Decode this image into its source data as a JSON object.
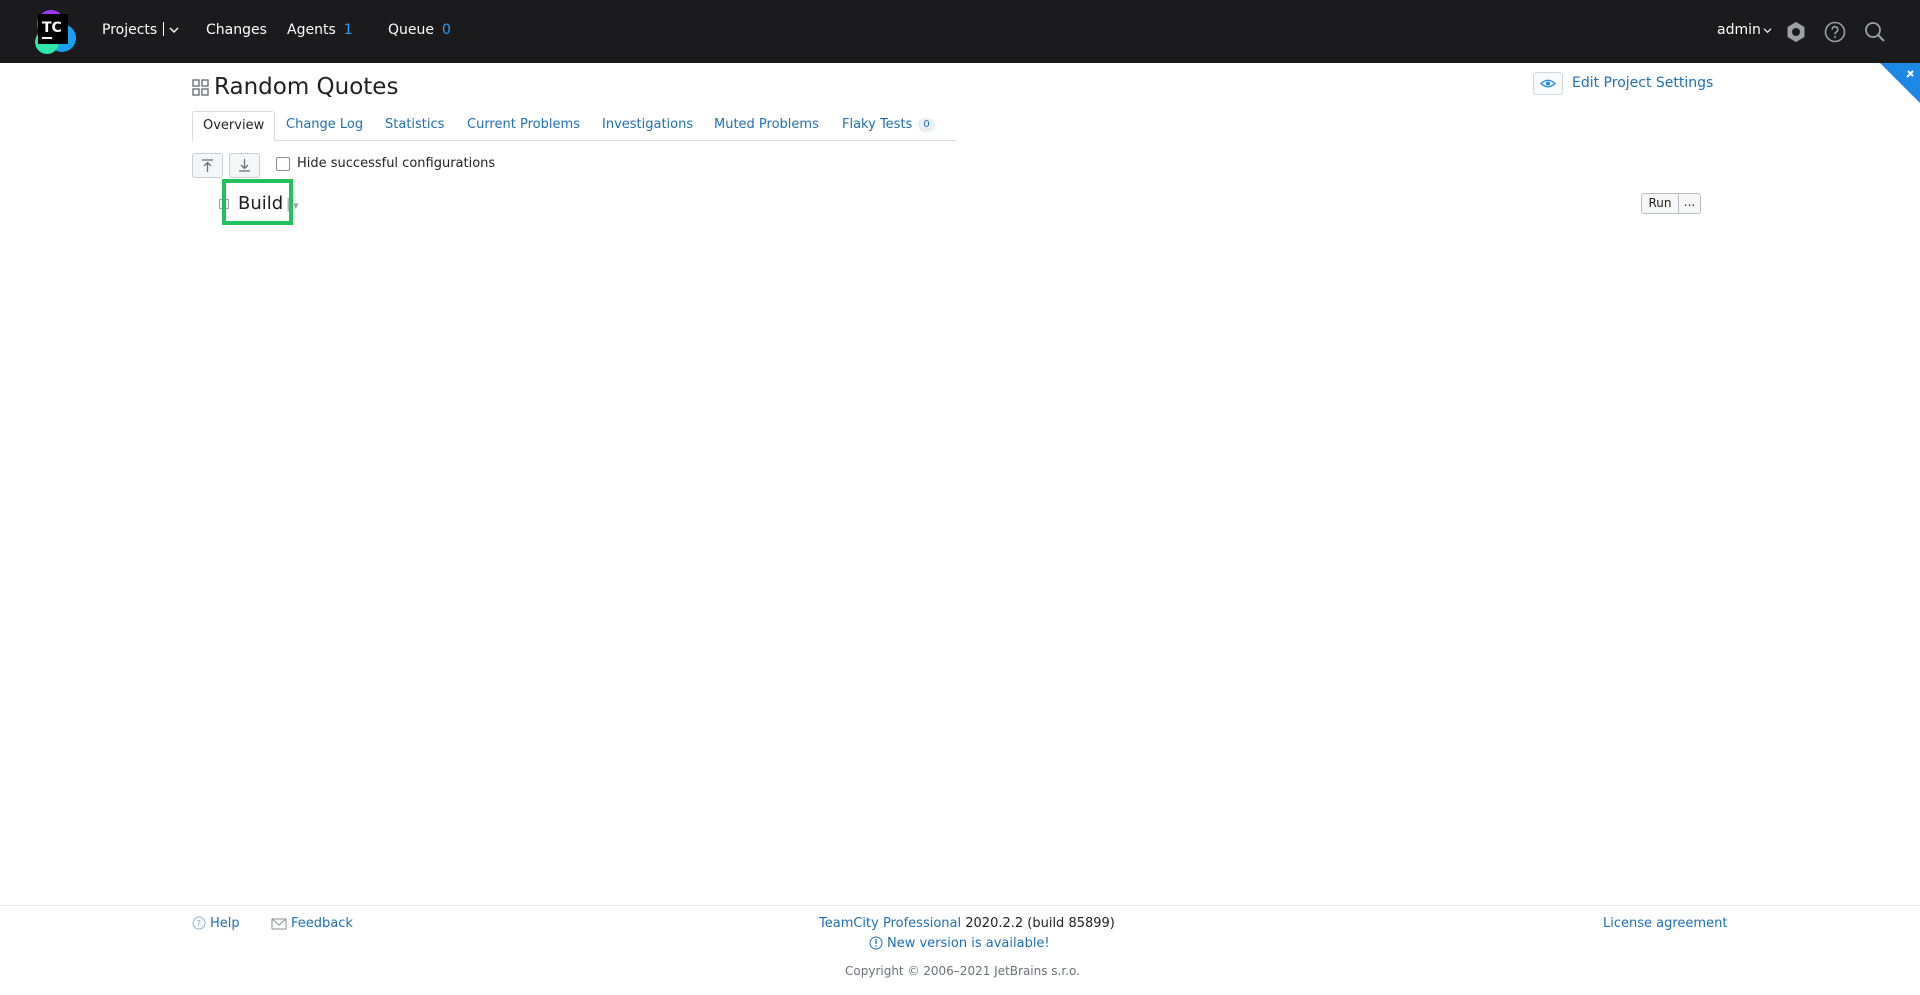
{
  "nav": {
    "projects": "Projects",
    "changes": "Changes",
    "agents": "Agents",
    "agents_count": "1",
    "queue": "Queue",
    "queue_count": "0",
    "user": "admin"
  },
  "header": {
    "title": "Random Quotes",
    "edit_settings": "Edit Project Settings"
  },
  "tabs": [
    {
      "label": "Overview",
      "active": true
    },
    {
      "label": "Change Log"
    },
    {
      "label": "Statistics"
    },
    {
      "label": "Current Problems"
    },
    {
      "label": "Investigations"
    },
    {
      "label": "Muted Problems"
    },
    {
      "label": "Flaky Tests",
      "badge": "0"
    }
  ],
  "toolbar": {
    "hide_successful": "Hide successful configurations"
  },
  "build": {
    "name": "Build",
    "pipe": "|",
    "run": "Run",
    "more": "..."
  },
  "footer": {
    "help": "Help",
    "feedback": "Feedback",
    "product": "TeamCity Professional",
    "version": "2020.2.2 (build 85899)",
    "new_version": "New version is available!",
    "copyright": "Copyright © 2006–2021 JetBrains s.r.o.",
    "license": "License agreement"
  },
  "colors": {
    "topbar": "#1b1b1d",
    "link": "#1f6fb2",
    "count": "#2a9df4",
    "highlight": "#21c15c"
  }
}
